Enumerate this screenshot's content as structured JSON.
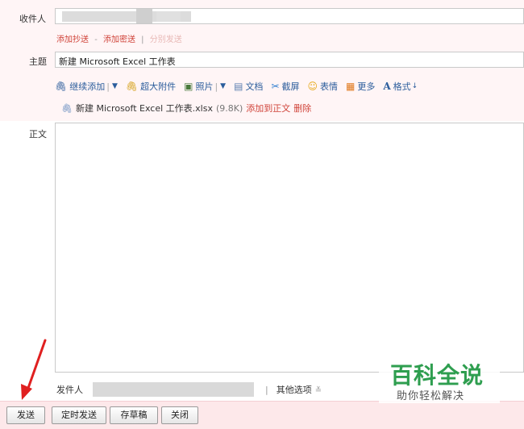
{
  "labels": {
    "recipient": "收件人",
    "subject": "主题",
    "body": "正文",
    "sender": "发件人"
  },
  "recipient_links": {
    "add_cc": "添加抄送",
    "separator": "-",
    "add_bcc": "添加密送",
    "pipe": "|",
    "separate_send": "分别发送"
  },
  "subject": {
    "value": "新建 Microsoft Excel 工作表"
  },
  "toolbar": {
    "continue_add": "继续添加",
    "large_attachment": "超大附件",
    "photo": "照片",
    "document": "文档",
    "screenshot": "截屏",
    "emoji": "表情",
    "more": "更多",
    "format": "格式"
  },
  "attachment": {
    "name": "新建 Microsoft Excel 工作表.xlsx",
    "size": "(9.8K)",
    "add_to_body": "添加到正文",
    "delete": "删除"
  },
  "sender_row": {
    "other_options": "其他选项",
    "pipe": "|"
  },
  "buttons": {
    "send": "发送",
    "timed_send": "定时发送",
    "save_draft": "存草稿",
    "close": "关闭"
  },
  "watermark": {
    "main": "百科全说",
    "sub": "助你轻松解决"
  },
  "colors": {
    "link_red": "#d0443a",
    "toolbar_blue": "#2b5d9c",
    "bottom_bar": "#fde8ea",
    "header_band": "#fff5f6",
    "watermark_green": "#2e9e4f",
    "arrow_red": "#e02020"
  }
}
